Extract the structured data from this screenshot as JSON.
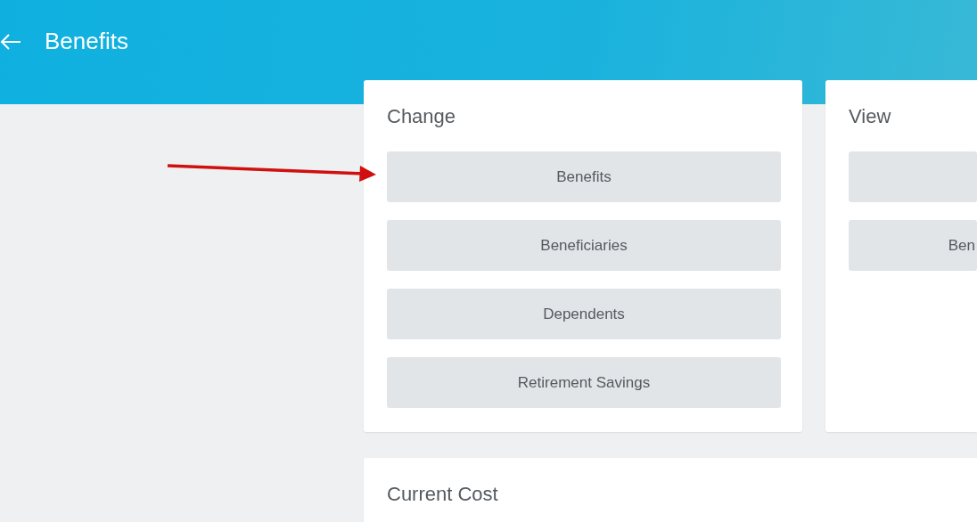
{
  "header": {
    "title": "Benefits"
  },
  "change": {
    "title": "Change",
    "buttons": [
      {
        "kind": "button",
        "label": "Benefits"
      },
      {
        "kind": "button",
        "label": "Beneficiaries"
      },
      {
        "kind": "button",
        "label": "Dependents"
      },
      {
        "kind": "button",
        "label": "Retirement Savings"
      }
    ]
  },
  "view": {
    "title": "View",
    "buttons": [
      {
        "kind": "button"
      },
      {
        "kind": "button",
        "label": "Ben"
      }
    ]
  },
  "current_cost": {
    "title": "Current Cost"
  }
}
